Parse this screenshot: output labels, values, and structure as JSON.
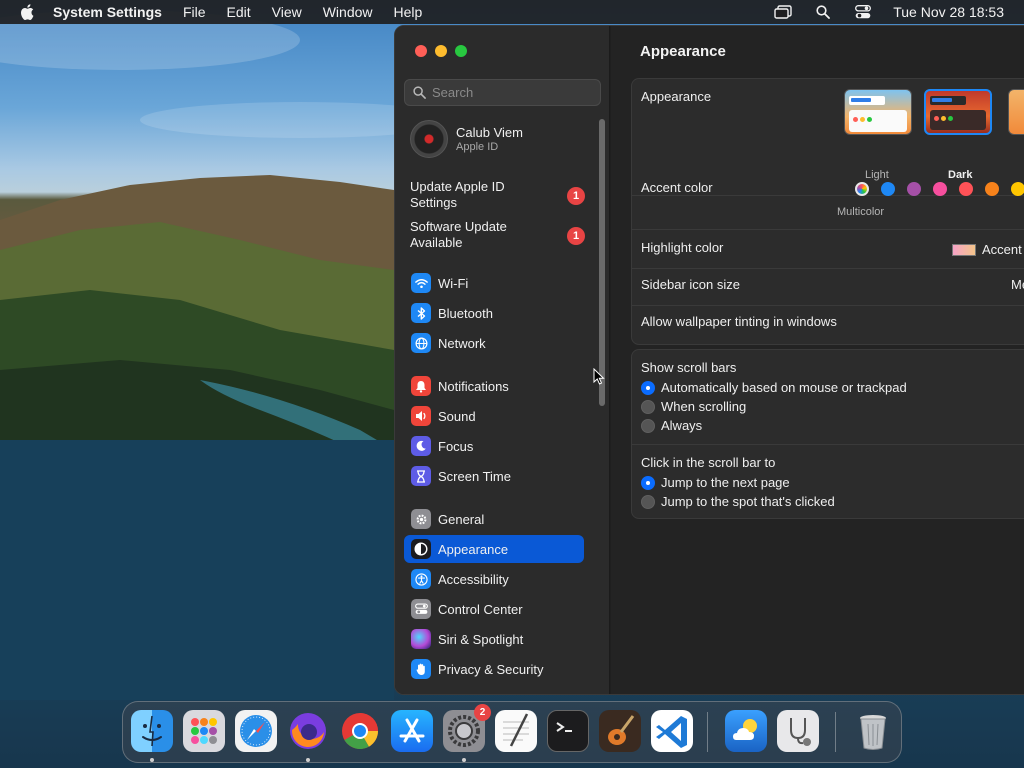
{
  "menubar": {
    "app_name": "System Settings",
    "menus": [
      "File",
      "Edit",
      "View",
      "Window",
      "Help"
    ],
    "clock": "Tue Nov 28  18:53"
  },
  "sidebar": {
    "search_placeholder": "Search",
    "account": {
      "name": "Calub Viem",
      "subtitle": "Apple ID"
    },
    "notices": [
      {
        "label": "Update Apple ID Settings",
        "badge": "1"
      },
      {
        "label": "Software Update Available",
        "badge": "1"
      }
    ],
    "items": [
      {
        "label": "Wi-Fi",
        "icon": "wifi-icon",
        "color": "#1e88f5"
      },
      {
        "label": "Bluetooth",
        "icon": "bluetooth-icon",
        "color": "#1e88f5"
      },
      {
        "label": "Network",
        "icon": "globe-icon",
        "color": "#1e88f5"
      },
      {
        "label": "Notifications",
        "icon": "bell-icon",
        "color": "#f0453a"
      },
      {
        "label": "Sound",
        "icon": "speaker-icon",
        "color": "#f0453a"
      },
      {
        "label": "Focus",
        "icon": "moon-icon",
        "color": "#5e5ce6"
      },
      {
        "label": "Screen Time",
        "icon": "hourglass-icon",
        "color": "#5e5ce6"
      },
      {
        "label": "General",
        "icon": "gear-icon",
        "color": "#8e8e93"
      },
      {
        "label": "Appearance",
        "icon": "appearance-icon",
        "color": "#1c1c1e"
      },
      {
        "label": "Accessibility",
        "icon": "accessibility-icon",
        "color": "#1e88f5"
      },
      {
        "label": "Control Center",
        "icon": "control-center-icon",
        "color": "#8e8e93"
      },
      {
        "label": "Siri & Spotlight",
        "icon": "siri-icon",
        "color": "#b44ad6"
      },
      {
        "label": "Privacy & Security",
        "icon": "hand-icon",
        "color": "#1e88f5"
      }
    ],
    "active_item": "Appearance"
  },
  "content": {
    "title": "Appearance",
    "appearance": {
      "label": "Appearance",
      "options": [
        {
          "label": "Light",
          "selected": false
        },
        {
          "label": "Dark",
          "selected": true
        }
      ]
    },
    "accent": {
      "label": "Accent color",
      "selected_label": "Multicolor",
      "colors": [
        "multicolor",
        "#1e88f5",
        "#a550a7",
        "#f74f9e",
        "#ff5257",
        "#f7821b",
        "#ffc600"
      ]
    },
    "highlight": {
      "label": "Highlight color",
      "value": "Accent"
    },
    "sidebar_icon_size": {
      "label": "Sidebar icon size",
      "value": "Me"
    },
    "wallpaper_tinting": {
      "label": "Allow wallpaper tinting in windows"
    },
    "scroll_bars": {
      "label": "Show scroll bars",
      "options": [
        {
          "label": "Automatically based on mouse or trackpad",
          "selected": true
        },
        {
          "label": "When scrolling",
          "selected": false
        },
        {
          "label": "Always",
          "selected": false
        }
      ]
    },
    "click_scroll": {
      "label": "Click in the scroll bar to",
      "options": [
        {
          "label": "Jump to the next page",
          "selected": true
        },
        {
          "label": "Jump to the spot that's clicked",
          "selected": false
        }
      ]
    }
  },
  "dock": {
    "apps": [
      {
        "icon": "finder-icon",
        "running": true
      },
      {
        "icon": "launchpad-icon",
        "running": false
      },
      {
        "icon": "safari-icon",
        "running": false
      },
      {
        "icon": "firefox-icon",
        "running": true
      },
      {
        "icon": "chrome-icon",
        "running": false
      },
      {
        "icon": "app-store-icon",
        "running": false
      },
      {
        "icon": "system-settings-icon",
        "running": true,
        "badge": "2"
      },
      {
        "icon": "textedit-icon",
        "running": false
      },
      {
        "icon": "terminal-icon",
        "running": false
      },
      {
        "icon": "garageband-icon",
        "running": false
      },
      {
        "icon": "vscode-icon",
        "running": false
      },
      {
        "icon": "weather-icon",
        "running": false
      },
      {
        "icon": "disk-utility-icon",
        "running": false
      },
      {
        "icon": "trash-icon",
        "running": false
      }
    ]
  }
}
